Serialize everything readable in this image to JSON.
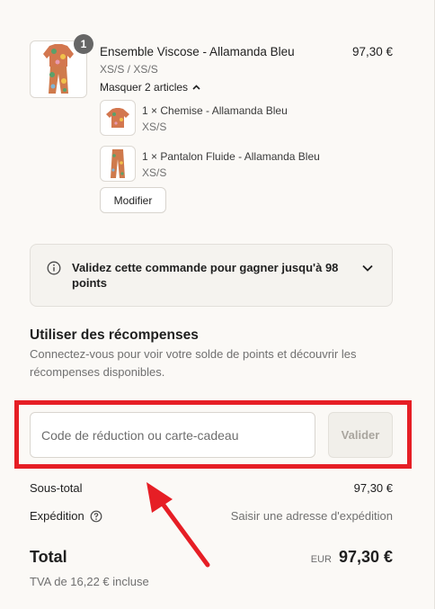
{
  "cart": {
    "product": {
      "name": "Ensemble Viscose - Allamanda Bleu",
      "variant": "XS/S / XS/S",
      "price": "97,30 €",
      "quantity_badge": "1",
      "toggle_label": "Masquer 2 articles"
    },
    "sub_items": [
      {
        "name": "1 × Chemise - Allamanda Bleu",
        "variant": "XS/S"
      },
      {
        "name": "1 × Pantalon Fluide - Allamanda Bleu",
        "variant": "XS/S"
      }
    ],
    "modify_label": "Modifier"
  },
  "points": {
    "message": "Validez cette commande pour gagner jusqu'à 98 points"
  },
  "rewards": {
    "title": "Utiliser des récompenses",
    "description": "Connectez-vous pour voir votre solde de points et découvrir les récompenses disponibles."
  },
  "discount": {
    "placeholder": "Code de réduction ou carte-cadeau",
    "button_label": "Valider"
  },
  "summary": {
    "subtotal_label": "Sous-total",
    "subtotal_value": "97,30 €",
    "shipping_label": "Expédition",
    "shipping_value": "Saisir une adresse d'expédition",
    "total_label": "Total",
    "currency": "EUR",
    "total_value": "97,30 €",
    "tax_note": "TVA de 16,22 € incluse"
  },
  "colors": {
    "annotation": "#e61e25",
    "background": "#fbf9f6"
  }
}
